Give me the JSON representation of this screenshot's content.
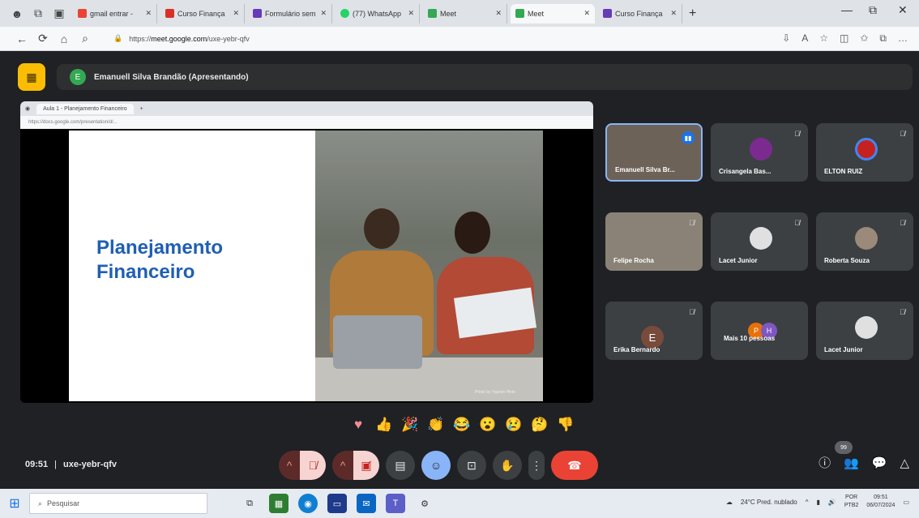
{
  "browser": {
    "tabs": [
      {
        "label": "gmail entrar - ",
        "color": "#ea4335"
      },
      {
        "label": "Curso Finança",
        "color": "#d93025"
      },
      {
        "label": "Formulário sem",
        "color": "#673ab7"
      },
      {
        "label": "(77) WhatsApp",
        "color": "#25d366"
      },
      {
        "label": "Meet",
        "color": "#ea4335"
      },
      {
        "label": "Meet",
        "color": "#ea4335"
      },
      {
        "label": "Curso Finança",
        "color": "#673ab7"
      }
    ],
    "url_prefix": "https://",
    "url_host": "meet.google.com",
    "url_path": "/uxe-yebr-qfv"
  },
  "meet": {
    "presenter_initial": "E",
    "presenter_label": "Emanuell Silva Brandão (Apresentando)",
    "slide_title_line1": "Planejamento",
    "slide_title_line2": "Financeiro",
    "photo_caption": "Photo by Yasmin Pinto",
    "inner_tab": "Aula 1 - Planejamento Financeiro",
    "inner_url": "https://docs.google.com/presentation/d/...",
    "participants": [
      {
        "name": "Emanuell Silva Br...",
        "type": "video"
      },
      {
        "name": "Crisangela Bas...",
        "type": "avatar"
      },
      {
        "name": "ELTON RUIZ",
        "type": "avatar"
      },
      {
        "name": "Felipe Rocha",
        "type": "video"
      },
      {
        "name": "Lacet Junior",
        "type": "avatar"
      },
      {
        "name": "Roberta Souza",
        "type": "avatar"
      },
      {
        "name": "Erika Bernardo",
        "type": "letter",
        "initial": "E"
      },
      {
        "name": "Mais 10 pessoas",
        "type": "more",
        "initials": [
          "P",
          "H"
        ]
      },
      {
        "name": "Lacet Junior",
        "type": "avatar"
      }
    ],
    "time": "09:51",
    "separator": "|",
    "meeting_code": "uxe-yebr-qfv",
    "notif_count": "99"
  },
  "taskbar": {
    "search_placeholder": "Pesquisar",
    "weather": "24°C  Pred. nublado",
    "lang": "POR",
    "lang2": "PTB2",
    "time": "09:51",
    "date": "06/07/2024"
  }
}
